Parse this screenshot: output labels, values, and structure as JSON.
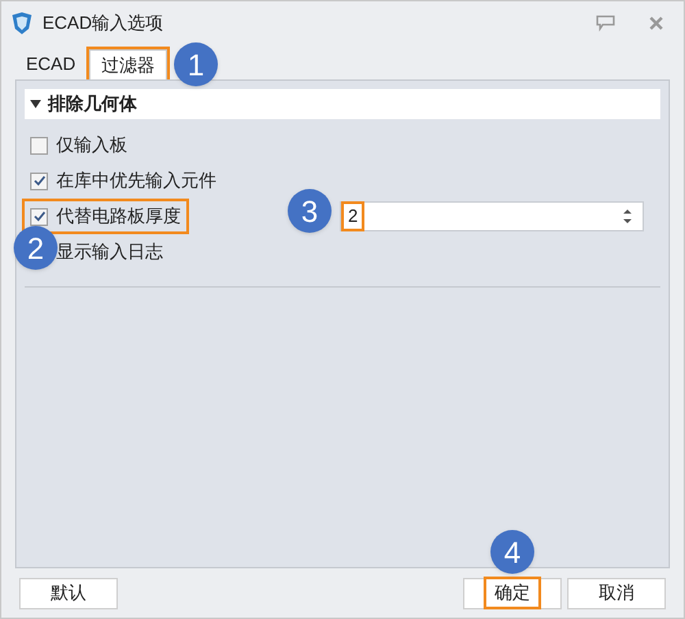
{
  "window": {
    "title": "ECAD输入选项"
  },
  "tabs": [
    {
      "label": "ECAD",
      "selected": false,
      "highlighted": false
    },
    {
      "label": "过滤器",
      "selected": true,
      "highlighted": true
    }
  ],
  "section": {
    "title": "排除几何体",
    "expanded": true
  },
  "options": [
    {
      "label": "仅输入板",
      "checked": false,
      "highlighted": false
    },
    {
      "label": "在库中优先输入元件",
      "checked": true,
      "highlighted": false
    },
    {
      "label": "代替电路板厚度",
      "checked": true,
      "highlighted": true
    },
    {
      "label": "显示输入日志",
      "highlighted": false
    }
  ],
  "thickness": {
    "value": "2",
    "highlighted": true
  },
  "buttons": [
    {
      "label": "默认",
      "highlighted": false
    },
    {
      "label": "确定",
      "highlighted": true
    },
    {
      "label": "取消",
      "highlighted": false
    }
  ],
  "callouts": [
    {
      "label": "1"
    },
    {
      "label": "2"
    },
    {
      "label": "3"
    },
    {
      "label": "4"
    }
  ]
}
